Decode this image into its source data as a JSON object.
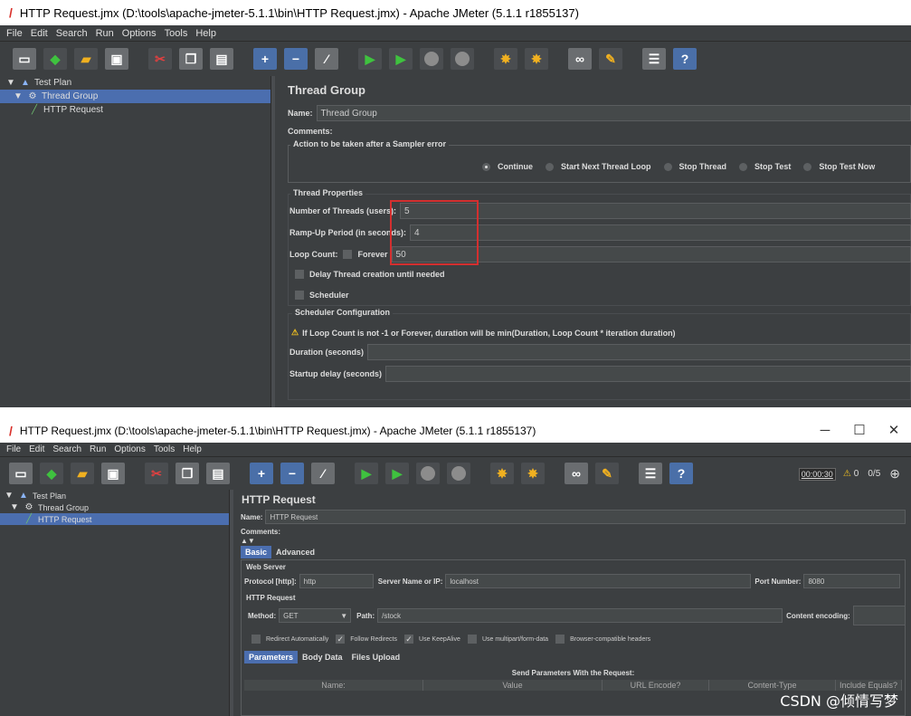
{
  "window1": {
    "title": "HTTP Request.jmx (D:\\tools\\apache-jmeter-5.1.1\\bin\\HTTP Request.jmx) - Apache JMeter (5.1.1 r1855137)",
    "menu": [
      "File",
      "Edit",
      "Search",
      "Run",
      "Options",
      "Tools",
      "Help"
    ],
    "tree": [
      {
        "label": "Test Plan",
        "icon": "test-plan-icon"
      },
      {
        "label": "Thread Group",
        "icon": "gear-icon",
        "selected": true
      },
      {
        "label": "HTTP Request",
        "icon": "pipette-icon"
      }
    ],
    "panel": {
      "title": "Thread Group",
      "name_label": "Name:",
      "name_value": "Thread Group",
      "comments_label": "Comments:",
      "error_action_label": "Action to be taken after a Sampler error",
      "error_options": [
        "Continue",
        "Start Next Thread Loop",
        "Stop Thread",
        "Stop Test",
        "Stop Test Now"
      ],
      "thread_props_label": "Thread Properties",
      "num_threads_label": "Number of Threads (users):",
      "num_threads_value": "5",
      "rampup_label": "Ramp-Up Period (in seconds):",
      "rampup_value": "4",
      "loop_label": "Loop Count:",
      "forever_label": "Forever",
      "loop_value": "50",
      "delay_label": "Delay Thread creation until needed",
      "scheduler_label": "Scheduler",
      "sched_config_label": "Scheduler Configuration",
      "warning_text": "If Loop Count is not -1 or Forever, duration will be min(Duration, Loop Count * iteration duration)",
      "duration_label": "Duration (seconds)",
      "startup_label": "Startup delay (seconds)"
    }
  },
  "window2": {
    "title": "HTTP Request.jmx (D:\\tools\\apache-jmeter-5.1.1\\bin\\HTTP Request.jmx) - Apache JMeter (5.1.1 r1855137)",
    "menu": [
      "File",
      "Edit",
      "Search",
      "Run",
      "Options",
      "Tools",
      "Help"
    ],
    "timer": "00:00:30",
    "warnings": "0",
    "threads": "0/5",
    "tree": [
      {
        "label": "Test Plan",
        "icon": "test-plan-icon"
      },
      {
        "label": "Thread Group",
        "icon": "gear-icon"
      },
      {
        "label": "HTTP Request",
        "icon": "pipette-icon",
        "selected": true
      }
    ],
    "panel": {
      "title": "HTTP Request",
      "name_label": "Name:",
      "name_value": "HTTP Request",
      "comments_label": "Comments:",
      "tabs": [
        "Basic",
        "Advanced"
      ],
      "web_server_label": "Web Server",
      "protocol_label": "Protocol [http]:",
      "protocol_value": "http",
      "server_label": "Server Name or IP:",
      "server_value": "localhost",
      "port_label": "Port Number:",
      "port_value": "8080",
      "http_request_label": "HTTP Request",
      "method_label": "Method:",
      "method_value": "GET",
      "path_label": "Path:",
      "path_value": "/stock",
      "encoding_label": "Content encoding:",
      "checkboxes": [
        {
          "label": "Redirect Automatically",
          "checked": false
        },
        {
          "label": "Follow Redirects",
          "checked": true
        },
        {
          "label": "Use KeepAlive",
          "checked": true
        },
        {
          "label": "Use multipart/form-data",
          "checked": false
        },
        {
          "label": "Browser-compatible headers",
          "checked": false
        }
      ],
      "subtabs": [
        "Parameters",
        "Body Data",
        "Files Upload"
      ],
      "send_params_label": "Send Parameters With the Request:",
      "columns": [
        "Name:",
        "Value",
        "URL Encode?",
        "Content-Type",
        "Include Equals?"
      ]
    }
  },
  "watermark": "CSDN @倾情写梦"
}
